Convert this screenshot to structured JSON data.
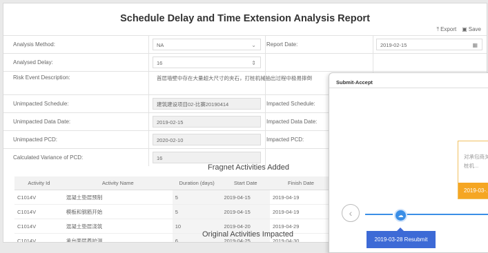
{
  "report": {
    "title": "Schedule Delay and Time Extension Analysis Report",
    "toolbar": {
      "export_label": "Export",
      "save_label": "Save"
    },
    "fields": {
      "analysis_method": {
        "label": "Analysis Method:",
        "value": "NA"
      },
      "report_date": {
        "label": "Report Date:",
        "value": "2019-02-15"
      },
      "analysed_delay": {
        "label": "Analysed Delay:",
        "value": "16"
      },
      "risk_event": {
        "label": "Risk Event Description:",
        "value": "首层墙壁中存在大量超大尺寸的夹石，打桩机械抽出过程中极易摔倒"
      },
      "unimpacted_schedule": {
        "label": "Unimpacted Schedule:",
        "value": "建筑建设项目02-比赛20190414"
      },
      "impacted_schedule": {
        "label": "Impacted Schedule:"
      },
      "unimpacted_data_date": {
        "label": "Unimpacted Data Date:",
        "value": "2019-02-15"
      },
      "impacted_data_date": {
        "label": "Impacted Data Date:"
      },
      "unimpacted_pcd": {
        "label": "Unimpacted PCD:",
        "value": "2020-02-10"
      },
      "impacted_pcd": {
        "label": "Impacted PCD:"
      },
      "variance_pcd": {
        "label": "Calculated Variance of PCD:",
        "value": "16"
      }
    },
    "fragnet": {
      "title": "Fragnet Activities Added",
      "columns": [
        "Activity Id",
        "Activity Name",
        "Duration (days)",
        "Start Date",
        "Finish Date"
      ],
      "rows": [
        [
          "C1014V",
          "混凝土垫层预制",
          "5",
          "2019-04-15",
          "2019-04-19"
        ],
        [
          "C1014V",
          "模板和钢筋开始",
          "5",
          "2019-04-15",
          "2019-04-19"
        ],
        [
          "C1014V",
          "混凝土垫层浇筑",
          "10",
          "2019-04-20",
          "2019-04-29"
        ],
        [
          "C1014V",
          "承台面层养护测",
          "6",
          "2019-04-25",
          "2019-04-30"
        ]
      ]
    },
    "original_title": "Original Activities Impacted"
  },
  "panel": {
    "title": "Submit-Accept",
    "card_text": "对承包商关...打桩机...",
    "card_date": "2019-03-...",
    "node_caption": "2019-03-28 Resubmit",
    "colors": {
      "accent": "#3a8ee6",
      "card": "#f5a623",
      "caption": "#3d6ad6"
    }
  }
}
